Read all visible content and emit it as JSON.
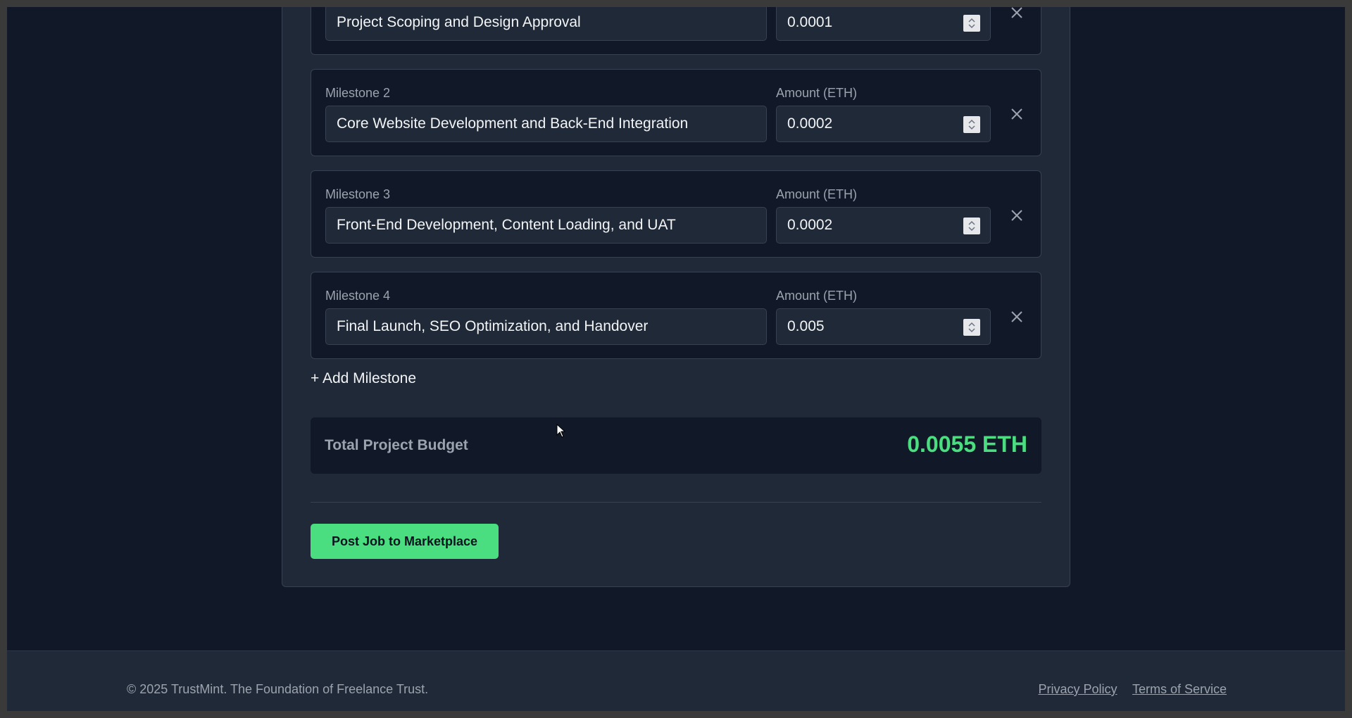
{
  "milestones": [
    {
      "label": "",
      "amount_label": "",
      "title": "Project Scoping and Design Approval",
      "amount": "0.0001"
    },
    {
      "label": "Milestone 2",
      "amount_label": "Amount (ETH)",
      "title": "Core Website Development and Back-End Integration",
      "amount": "0.0002"
    },
    {
      "label": "Milestone 3",
      "amount_label": "Amount (ETH)",
      "title": "Front-End Development, Content Loading, and UAT",
      "amount": "0.0002"
    },
    {
      "label": "Milestone 4",
      "amount_label": "Amount (ETH)",
      "title": "Final Launch, SEO Optimization, and Handover",
      "amount": "0.005"
    }
  ],
  "add_milestone_label": "+ Add Milestone",
  "budget": {
    "label": "Total Project Budget",
    "value": "0.0055 ETH"
  },
  "post_button_label": "Post Job to Marketplace",
  "footer": {
    "copyright": "© 2025 TrustMint. The Foundation of Freelance Trust.",
    "privacy": "Privacy Policy",
    "terms": "Terms of Service"
  },
  "colors": {
    "accent": "#4ade80",
    "background": "#111827",
    "card": "#1f2937"
  },
  "icons": {
    "remove": "close-icon",
    "spinner": "number-spinner-icon"
  }
}
